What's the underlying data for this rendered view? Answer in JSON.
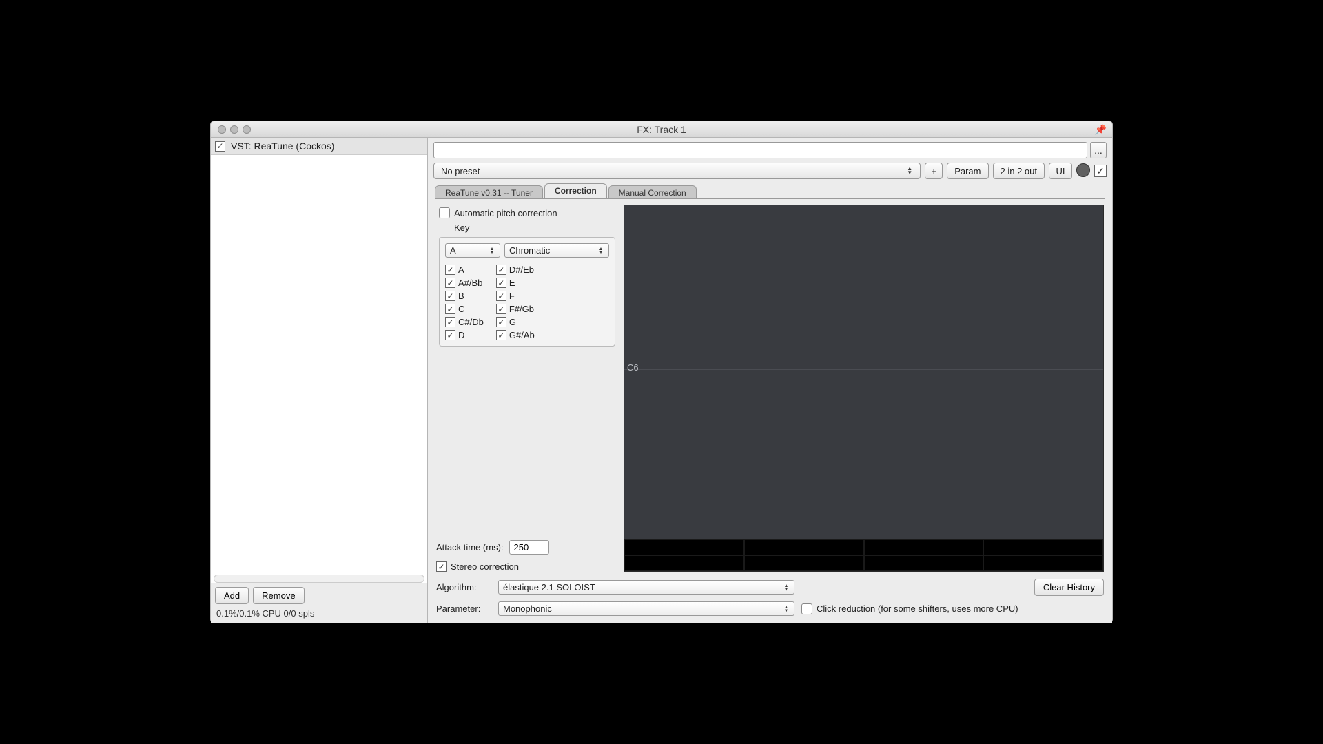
{
  "window": {
    "title": "FX: Track 1"
  },
  "sidebar": {
    "fx_name": "VST: ReaTune (Cockos)",
    "add": "Add",
    "remove": "Remove",
    "cpu": "0.1%/0.1% CPU 0/0 spls"
  },
  "topbar": {
    "ellipsis": "...",
    "preset": "No preset",
    "plus": "+",
    "param": "Param",
    "io": "2 in 2 out",
    "ui": "UI"
  },
  "tabs": {
    "tuner": "ReaTune v0.31 -- Tuner",
    "correction": "Correction",
    "manual": "Manual Correction"
  },
  "correction": {
    "auto_label": "Automatic pitch correction",
    "key_label": "Key",
    "key_root": "A",
    "key_scale": "Chromatic",
    "notes_col1": [
      "A",
      "A#/Bb",
      "B",
      "C",
      "C#/Db",
      "D"
    ],
    "notes_col2": [
      "D#/Eb",
      "E",
      "F",
      "F#/Gb",
      "G",
      "G#/Ab"
    ],
    "attack_label": "Attack time (ms):",
    "attack_value": "250",
    "stereo_label": "Stereo correction",
    "display_note": "C6"
  },
  "bottom": {
    "algo_label": "Algorithm:",
    "algo_value": "élastique 2.1 SOLOIST",
    "param_label": "Parameter:",
    "param_value": "Monophonic",
    "click_reduction": "Click reduction (for some shifters, uses more CPU)",
    "clear_history": "Clear History"
  }
}
